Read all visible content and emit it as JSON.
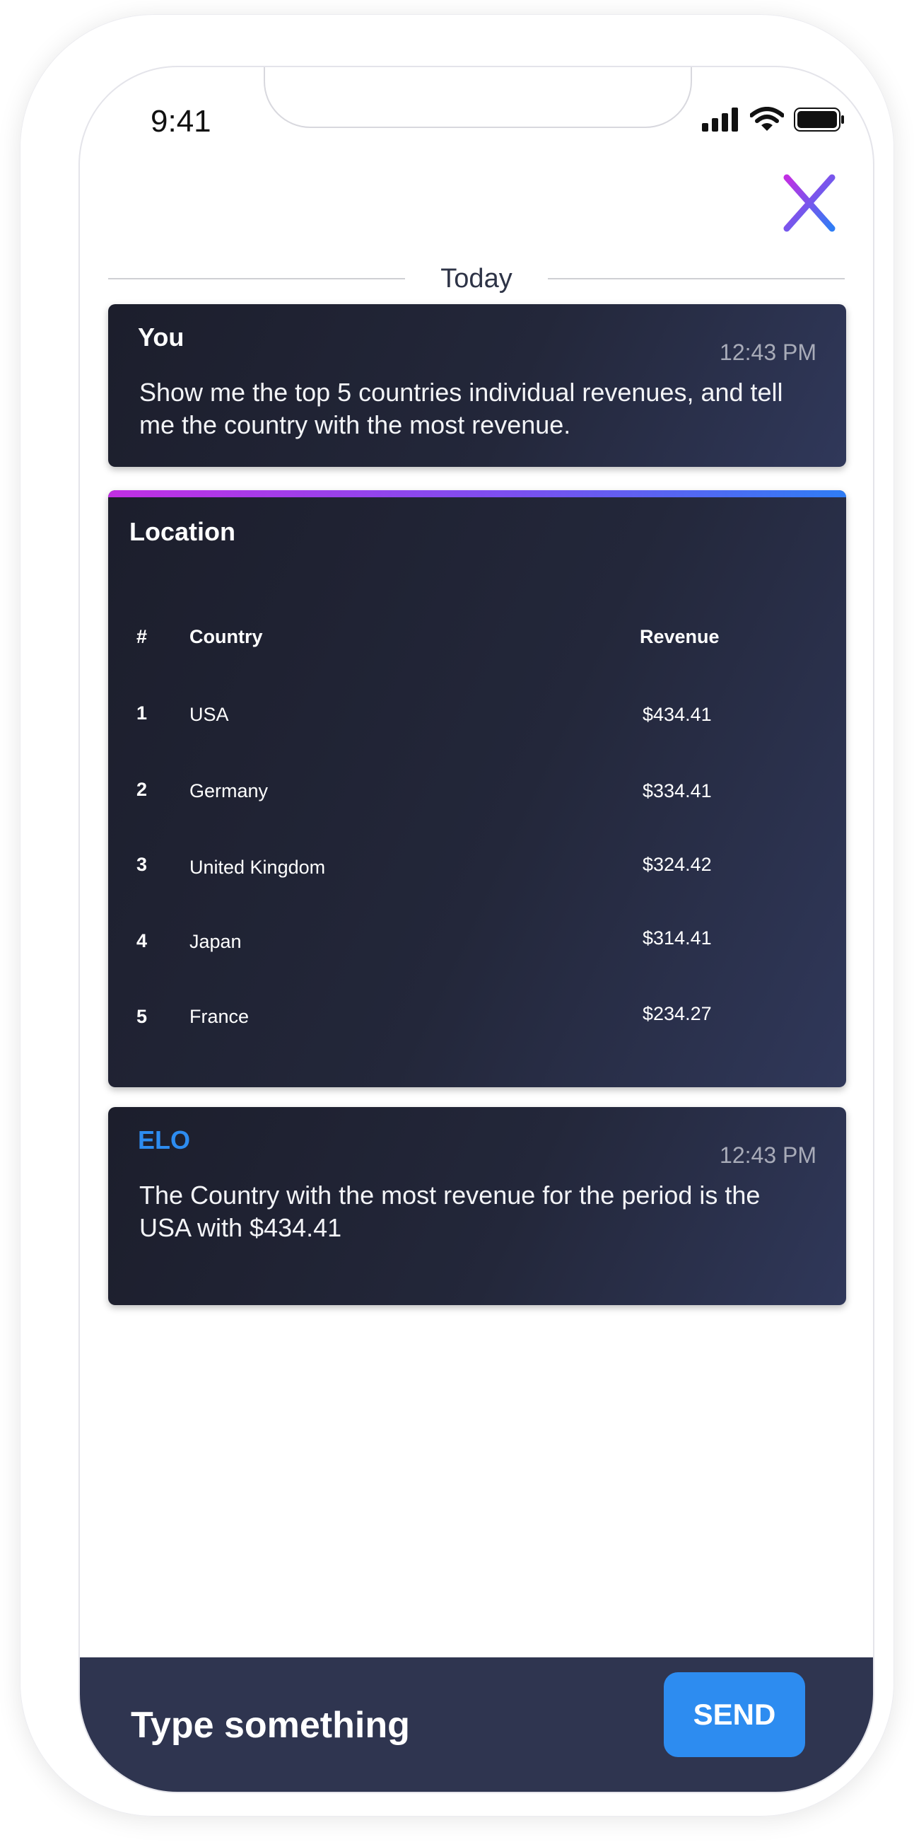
{
  "status_bar": {
    "time": "9:41"
  },
  "divider": {
    "label": "Today"
  },
  "user_message": {
    "sender": "You",
    "time": "12:43 PM",
    "text": "Show me the top 5 countries individual revenues, and tell me the country with the most revenue."
  },
  "location_table": {
    "title": "Location",
    "headers": {
      "num": "#",
      "country": "Country",
      "revenue": "Revenue"
    },
    "rows": [
      {
        "num": "1",
        "country": "USA",
        "revenue": "$434.41"
      },
      {
        "num": "2",
        "country": "Germany",
        "revenue": "$334.41"
      },
      {
        "num": "3",
        "country": "United Kingdom",
        "revenue": "$324.42"
      },
      {
        "num": "4",
        "country": "Japan",
        "revenue": "$314.41"
      },
      {
        "num": "5",
        "country": "France",
        "revenue": "$234.27"
      }
    ]
  },
  "bot_message": {
    "sender": "ELO",
    "time": "12:43 PM",
    "text": "The Country with the most revenue for the period is the USA with $434.41"
  },
  "composer": {
    "placeholder": "Type something",
    "send_label": "SEND"
  },
  "colors": {
    "accent_blue": "#2d8cf0",
    "card_dark": "#1c1e2c",
    "composer_bg": "#2f3550",
    "close_gradient_start": "#c12fe3",
    "close_gradient_end": "#2f7df5"
  }
}
